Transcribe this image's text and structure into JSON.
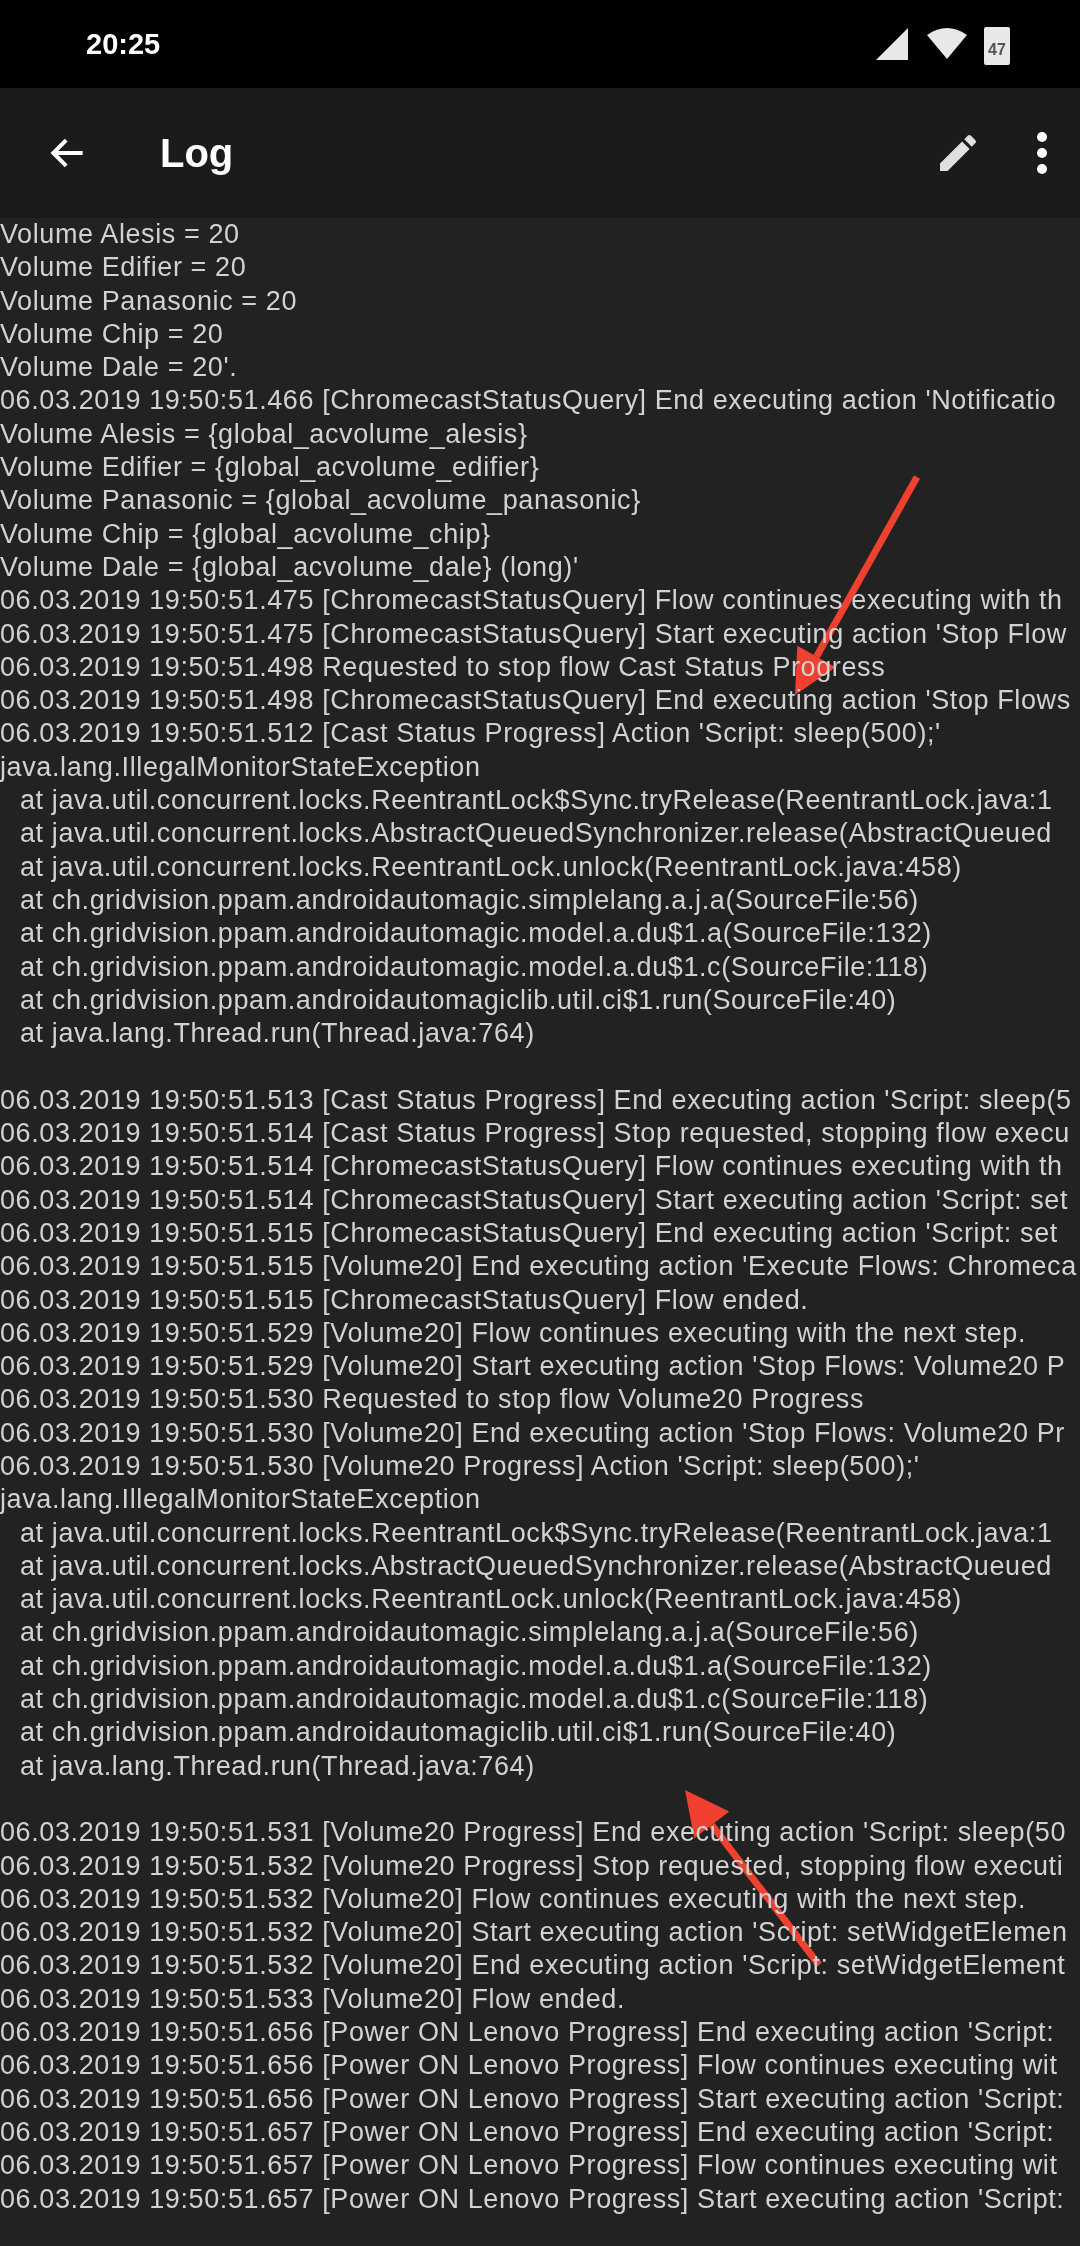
{
  "status_bar": {
    "time": "20:25",
    "battery": "47"
  },
  "toolbar": {
    "title": "Log"
  },
  "log_lines": [
    {
      "kind": "entry",
      "text": "Volume Alesis = 20"
    },
    {
      "kind": "entry",
      "text": "Volume Edifier = 20"
    },
    {
      "kind": "entry",
      "text": "Volume Panasonic = 20"
    },
    {
      "kind": "entry",
      "text": "Volume Chip = 20"
    },
    {
      "kind": "entry",
      "text": "Volume Dale = 20'."
    },
    {
      "kind": "entry",
      "text": "06.03.2019 19:50:51.466 [ChromecastStatusQuery] End executing action 'Notificatio"
    },
    {
      "kind": "entry",
      "text": "Volume Alesis = {global_acvolume_alesis}"
    },
    {
      "kind": "entry",
      "text": "Volume Edifier = {global_acvolume_edifier}"
    },
    {
      "kind": "entry",
      "text": "Volume Panasonic = {global_acvolume_panasonic}"
    },
    {
      "kind": "entry",
      "text": "Volume Chip = {global_acvolume_chip}"
    },
    {
      "kind": "entry",
      "text": "Volume Dale = {global_acvolume_dale} (long)'"
    },
    {
      "kind": "entry",
      "text": "06.03.2019 19:50:51.475 [ChromecastStatusQuery] Flow continues executing with th"
    },
    {
      "kind": "entry",
      "text": "06.03.2019 19:50:51.475 [ChromecastStatusQuery] Start executing action 'Stop Flow"
    },
    {
      "kind": "entry",
      "text": "06.03.2019 19:50:51.498 Requested to stop flow Cast Status Progress"
    },
    {
      "kind": "entry",
      "text": "06.03.2019 19:50:51.498 [ChromecastStatusQuery] End executing action 'Stop Flows"
    },
    {
      "kind": "entry",
      "text": "06.03.2019 19:50:51.512 [Cast Status Progress] Action 'Script: sleep(500);'"
    },
    {
      "kind": "entry",
      "text": "java.lang.IllegalMonitorStateException"
    },
    {
      "kind": "trace",
      "text": "at java.util.concurrent.locks.ReentrantLock$Sync.tryRelease(ReentrantLock.java:1"
    },
    {
      "kind": "trace",
      "text": "at java.util.concurrent.locks.AbstractQueuedSynchronizer.release(AbstractQueued"
    },
    {
      "kind": "trace",
      "text": "at java.util.concurrent.locks.ReentrantLock.unlock(ReentrantLock.java:458)"
    },
    {
      "kind": "trace",
      "text": "at ch.gridvision.ppam.androidautomagic.simplelang.a.j.a(SourceFile:56)"
    },
    {
      "kind": "trace",
      "text": "at ch.gridvision.ppam.androidautomagic.model.a.du$1.a(SourceFile:132)"
    },
    {
      "kind": "trace",
      "text": "at ch.gridvision.ppam.androidautomagic.model.a.du$1.c(SourceFile:118)"
    },
    {
      "kind": "trace",
      "text": "at ch.gridvision.ppam.androidautomagiclib.util.ci$1.run(SourceFile:40)"
    },
    {
      "kind": "trace",
      "text": "at java.lang.Thread.run(Thread.java:764)"
    },
    {
      "kind": "entry",
      "text": "06.03.2019 19:50:51.513 [Cast Status Progress] End executing action 'Script: sleep(5",
      "break_before": true
    },
    {
      "kind": "entry",
      "text": "06.03.2019 19:50:51.514 [Cast Status Progress] Stop requested, stopping flow execu"
    },
    {
      "kind": "entry",
      "text": "06.03.2019 19:50:51.514 [ChromecastStatusQuery] Flow continues executing with th"
    },
    {
      "kind": "entry",
      "text": "06.03.2019 19:50:51.514 [ChromecastStatusQuery] Start executing action 'Script: set"
    },
    {
      "kind": "entry",
      "text": "06.03.2019 19:50:51.515 [ChromecastStatusQuery] End executing action 'Script: set"
    },
    {
      "kind": "entry",
      "text": "06.03.2019 19:50:51.515 [Volume20] End executing action 'Execute Flows: Chromeca"
    },
    {
      "kind": "entry",
      "text": "06.03.2019 19:50:51.515 [ChromecastStatusQuery] Flow ended."
    },
    {
      "kind": "entry",
      "text": "06.03.2019 19:50:51.529 [Volume20] Flow continues executing with the next step."
    },
    {
      "kind": "entry",
      "text": "06.03.2019 19:50:51.529 [Volume20] Start executing action 'Stop Flows: Volume20 P"
    },
    {
      "kind": "entry",
      "text": "06.03.2019 19:50:51.530 Requested to stop flow Volume20 Progress"
    },
    {
      "kind": "entry",
      "text": "06.03.2019 19:50:51.530 [Volume20] End executing action 'Stop Flows: Volume20 Pr"
    },
    {
      "kind": "entry",
      "text": "06.03.2019 19:50:51.530 [Volume20 Progress] Action 'Script: sleep(500);'"
    },
    {
      "kind": "entry",
      "text": "java.lang.IllegalMonitorStateException"
    },
    {
      "kind": "trace",
      "text": "at java.util.concurrent.locks.ReentrantLock$Sync.tryRelease(ReentrantLock.java:1"
    },
    {
      "kind": "trace",
      "text": "at java.util.concurrent.locks.AbstractQueuedSynchronizer.release(AbstractQueued"
    },
    {
      "kind": "trace",
      "text": "at java.util.concurrent.locks.ReentrantLock.unlock(ReentrantLock.java:458)"
    },
    {
      "kind": "trace",
      "text": "at ch.gridvision.ppam.androidautomagic.simplelang.a.j.a(SourceFile:56)"
    },
    {
      "kind": "trace",
      "text": "at ch.gridvision.ppam.androidautomagic.model.a.du$1.a(SourceFile:132)"
    },
    {
      "kind": "trace",
      "text": "at ch.gridvision.ppam.androidautomagic.model.a.du$1.c(SourceFile:118)"
    },
    {
      "kind": "trace",
      "text": "at ch.gridvision.ppam.androidautomagiclib.util.ci$1.run(SourceFile:40)"
    },
    {
      "kind": "trace",
      "text": "at java.lang.Thread.run(Thread.java:764)"
    },
    {
      "kind": "entry",
      "text": "06.03.2019 19:50:51.531 [Volume20 Progress] End executing action 'Script: sleep(50",
      "break_before": true
    },
    {
      "kind": "entry",
      "text": "06.03.2019 19:50:51.532 [Volume20 Progress] Stop requested, stopping flow executi"
    },
    {
      "kind": "entry",
      "text": "06.03.2019 19:50:51.532 [Volume20] Flow continues executing with the next step."
    },
    {
      "kind": "entry",
      "text": "06.03.2019 19:50:51.532 [Volume20] Start executing action 'Script: setWidgetElemen"
    },
    {
      "kind": "entry",
      "text": "06.03.2019 19:50:51.532 [Volume20] End executing action 'Script: setWidgetElement"
    },
    {
      "kind": "entry",
      "text": "06.03.2019 19:50:51.533 [Volume20] Flow ended."
    },
    {
      "kind": "entry",
      "text": "06.03.2019 19:50:51.656 [Power ON Lenovo Progress] End executing action 'Script:"
    },
    {
      "kind": "entry",
      "text": "06.03.2019 19:50:51.656 [Power ON Lenovo Progress] Flow continues executing wit"
    },
    {
      "kind": "entry",
      "text": "06.03.2019 19:50:51.656 [Power ON Lenovo Progress] Start executing action 'Script:"
    },
    {
      "kind": "entry",
      "text": "06.03.2019 19:50:51.657 [Power ON Lenovo Progress] End executing action 'Script:"
    },
    {
      "kind": "entry",
      "text": "06.03.2019 19:50:51.657 [Power ON Lenovo Progress] Flow continues executing wit"
    },
    {
      "kind": "entry",
      "text": "06.03.2019 19:50:51.657 [Power ON Lenovo Progress] Start executing action 'Script:"
    }
  ]
}
